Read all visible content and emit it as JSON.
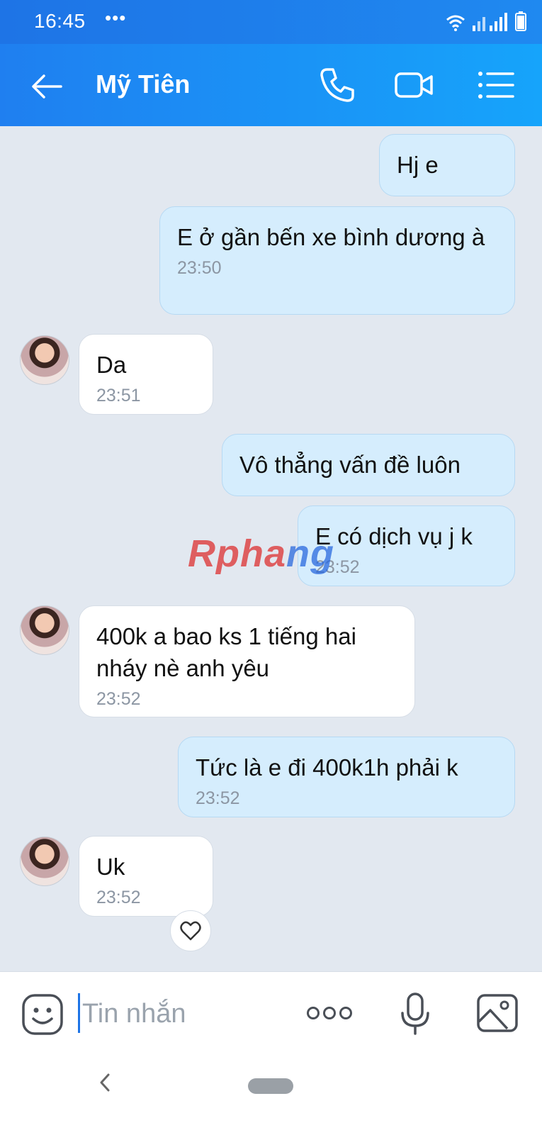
{
  "status_bar": {
    "time": "16:45",
    "dots": "•••"
  },
  "header": {
    "contact_name": "Mỹ Tiên"
  },
  "watermark": {
    "part1": "Rpha",
    "part2": "ng"
  },
  "messages": [
    {
      "direction": "out",
      "text": "Hj e",
      "time": ""
    },
    {
      "direction": "out",
      "text": "E ở gần bến xe bình dương à",
      "time": "23:50"
    },
    {
      "direction": "in",
      "text": "Da",
      "time": "23:51"
    },
    {
      "direction": "out",
      "text": "Vô thẳng vấn đề luôn",
      "time": ""
    },
    {
      "direction": "out",
      "text": "E có dịch vụ j k",
      "time": "23:52"
    },
    {
      "direction": "in",
      "text": "400k a bao ks 1 tiếng hai nháy nè anh yêu",
      "time": "23:52"
    },
    {
      "direction": "out",
      "text": "Tức là e đi 400k1h phải k",
      "time": "23:52"
    },
    {
      "direction": "in",
      "text": "Uk",
      "time": "23:52"
    }
  ],
  "composer": {
    "placeholder": "Tin nhắn"
  },
  "colors": {
    "header_start": "#1f7ff0",
    "header_end": "#16a4fb",
    "bubble_out": "#d5edfd",
    "bubble_in": "#ffffff"
  },
  "icons": [
    "back-arrow-icon",
    "phone-icon",
    "video-call-icon",
    "menu-list-icon",
    "heart-icon",
    "emoji-icon",
    "more-icon",
    "microphone-icon",
    "image-icon"
  ]
}
